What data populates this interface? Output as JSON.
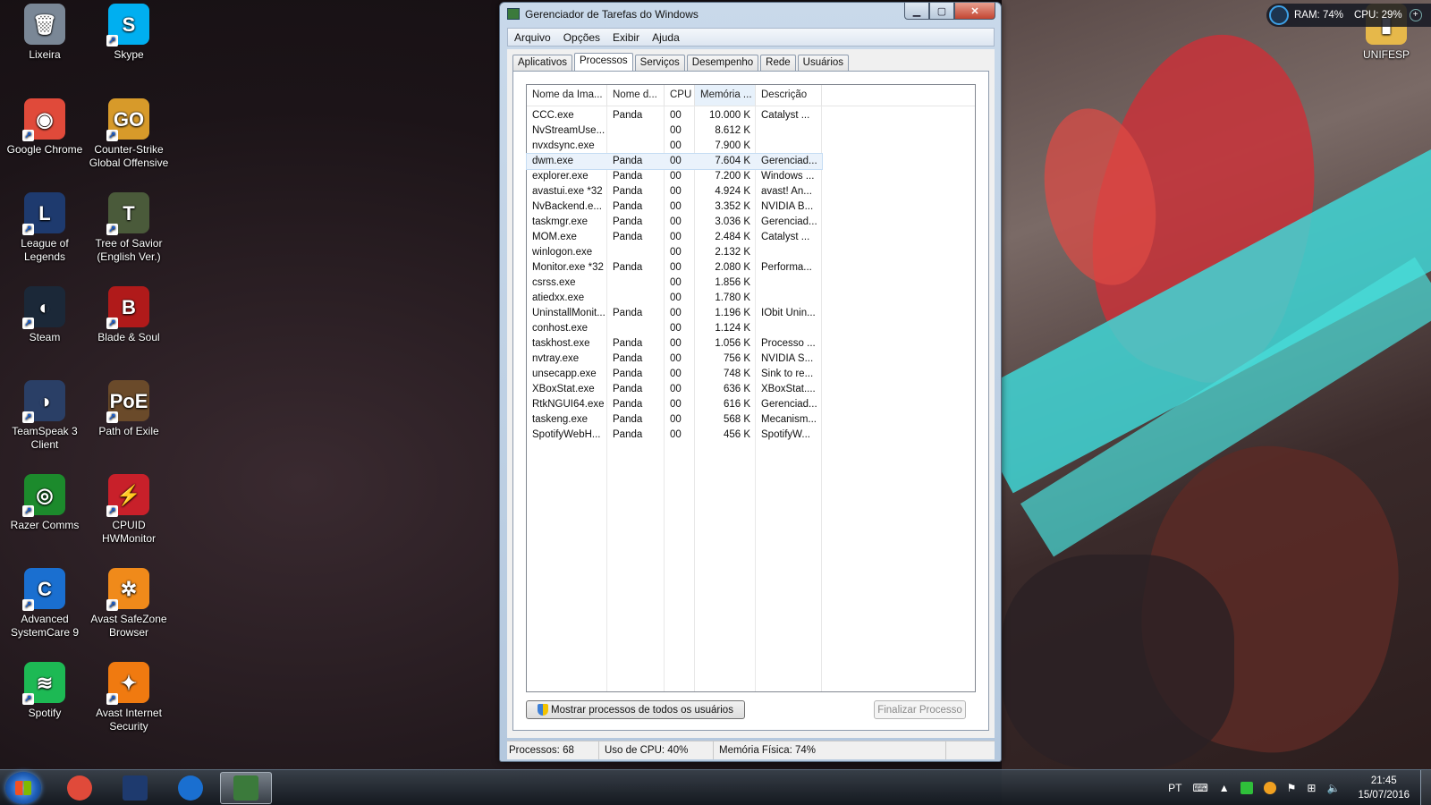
{
  "desktop": {
    "icons": [
      {
        "label": "Lixeira",
        "icon": "recycle-bin-icon",
        "glyph": "🗑",
        "color": "#7a8796"
      },
      {
        "label": "Skype",
        "icon": "skype-icon",
        "glyph": "S",
        "color": "#00aff0"
      },
      {
        "label": "Google Chrome",
        "icon": "chrome-icon",
        "glyph": "◉",
        "color": "#e04a3a"
      },
      {
        "label": "Counter-Strike Global Offensive",
        "icon": "csgo-icon",
        "glyph": "GO",
        "color": "#d79a2a"
      },
      {
        "label": "League of Legends",
        "icon": "league-of-legends-icon",
        "glyph": "L",
        "color": "#1e3a6e"
      },
      {
        "label": "Tree of Savior (English Ver.)",
        "icon": "tree-of-savior-icon",
        "glyph": "T",
        "color": "#4a5a3a"
      },
      {
        "label": "Steam",
        "icon": "steam-icon",
        "glyph": "◐",
        "color": "#1b2838"
      },
      {
        "label": "Blade & Soul",
        "icon": "blade-and-soul-icon",
        "glyph": "B",
        "color": "#b01a1a"
      },
      {
        "label": "TeamSpeak 3 Client",
        "icon": "teamspeak-icon",
        "glyph": "◑",
        "color": "#2a3f66"
      },
      {
        "label": "Path of Exile",
        "icon": "path-of-exile-icon",
        "glyph": "PoE",
        "color": "#6a4a2a"
      },
      {
        "label": "Razer Comms",
        "icon": "razer-comms-icon",
        "glyph": "◎",
        "color": "#1c8a2c"
      },
      {
        "label": "CPUID HWMonitor",
        "icon": "hwmonitor-icon",
        "glyph": "⚡",
        "color": "#c8202a"
      },
      {
        "label": "Advanced SystemCare 9",
        "icon": "advanced-systemcare-icon",
        "glyph": "C",
        "color": "#1a6fd0"
      },
      {
        "label": "Avast SafeZone Browser",
        "icon": "avast-safezone-icon",
        "glyph": "✲",
        "color": "#f08a1a"
      },
      {
        "label": "Spotify",
        "icon": "spotify-icon",
        "glyph": "≋",
        "color": "#1db954"
      },
      {
        "label": "Avast Internet Security",
        "icon": "avast-internet-security-icon",
        "glyph": "✦",
        "color": "#f07a10"
      },
      {
        "label": "UNIFESP",
        "icon": "folder-icon",
        "glyph": "▮",
        "color": "#e6b84a"
      }
    ]
  },
  "gadget": {
    "ram": "RAM: 74%",
    "cpu": "CPU: 29%"
  },
  "window": {
    "title": "Gerenciador de Tarefas do Windows",
    "menu": [
      "Arquivo",
      "Opções",
      "Exibir",
      "Ajuda"
    ],
    "tabs": [
      "Aplicativos",
      "Processos",
      "Serviços",
      "Desempenho",
      "Rede",
      "Usuários"
    ],
    "active_tab": "Processos",
    "columns": [
      "Nome da Ima...",
      "Nome d...",
      "CPU",
      "Memória ...",
      "Descrição"
    ],
    "processes": [
      {
        "image": "CCC.exe",
        "user": "Panda",
        "cpu": "00",
        "memory": "10.000 K",
        "description": "Catalyst ..."
      },
      {
        "image": "NvStreamUse...",
        "user": "",
        "cpu": "00",
        "memory": "8.612 K",
        "description": ""
      },
      {
        "image": "nvxdsync.exe",
        "user": "",
        "cpu": "00",
        "memory": "7.900 K",
        "description": ""
      },
      {
        "image": "dwm.exe",
        "user": "Panda",
        "cpu": "00",
        "memory": "7.604 K",
        "description": "Gerenciad..."
      },
      {
        "image": "explorer.exe",
        "user": "Panda",
        "cpu": "00",
        "memory": "7.200 K",
        "description": "Windows ..."
      },
      {
        "image": "avastui.exe *32",
        "user": "Panda",
        "cpu": "00",
        "memory": "4.924 K",
        "description": "avast! An..."
      },
      {
        "image": "NvBackend.e...",
        "user": "Panda",
        "cpu": "00",
        "memory": "3.352 K",
        "description": "NVIDIA B..."
      },
      {
        "image": "taskmgr.exe",
        "user": "Panda",
        "cpu": "00",
        "memory": "3.036 K",
        "description": "Gerenciad..."
      },
      {
        "image": "MOM.exe",
        "user": "Panda",
        "cpu": "00",
        "memory": "2.484 K",
        "description": "Catalyst ..."
      },
      {
        "image": "winlogon.exe",
        "user": "",
        "cpu": "00",
        "memory": "2.132 K",
        "description": ""
      },
      {
        "image": "Monitor.exe *32",
        "user": "Panda",
        "cpu": "00",
        "memory": "2.080 K",
        "description": "Performa..."
      },
      {
        "image": "csrss.exe",
        "user": "",
        "cpu": "00",
        "memory": "1.856 K",
        "description": ""
      },
      {
        "image": "atiedxx.exe",
        "user": "",
        "cpu": "00",
        "memory": "1.780 K",
        "description": ""
      },
      {
        "image": "UninstallMonit...",
        "user": "Panda",
        "cpu": "00",
        "memory": "1.196 K",
        "description": "IObit Unin..."
      },
      {
        "image": "conhost.exe",
        "user": "",
        "cpu": "00",
        "memory": "1.124 K",
        "description": ""
      },
      {
        "image": "taskhost.exe",
        "user": "Panda",
        "cpu": "00",
        "memory": "1.056 K",
        "description": "Processo ..."
      },
      {
        "image": "nvtray.exe",
        "user": "Panda",
        "cpu": "00",
        "memory": "756 K",
        "description": "NVIDIA S..."
      },
      {
        "image": "unsecapp.exe",
        "user": "Panda",
        "cpu": "00",
        "memory": "748 K",
        "description": "Sink to re..."
      },
      {
        "image": "XBoxStat.exe",
        "user": "Panda",
        "cpu": "00",
        "memory": "636 K",
        "description": "XBoxStat...."
      },
      {
        "image": "RtkNGUI64.exe",
        "user": "Panda",
        "cpu": "00",
        "memory": "616 K",
        "description": "Gerenciad..."
      },
      {
        "image": "taskeng.exe",
        "user": "Panda",
        "cpu": "00",
        "memory": "568 K",
        "description": "Mecanism..."
      },
      {
        "image": "SpotifyWebH...",
        "user": "Panda",
        "cpu": "00",
        "memory": "456 K",
        "description": "SpotifyW..."
      }
    ],
    "selected_row": "dwm.exe",
    "show_all_button": "Mostrar processos de todos os usuários",
    "end_process_button": "Finalizar Processo",
    "status": {
      "processes": "Processos: 68",
      "cpu": "Uso de CPU: 40%",
      "memory": "Memória Física: 74%"
    }
  },
  "taskbar": {
    "pinned": [
      {
        "name": "chrome",
        "icon": "chrome-icon",
        "color": "#e04a3a"
      },
      {
        "name": "league-of-legends",
        "icon": "league-of-legends-icon",
        "color": "#1e3a6e"
      },
      {
        "name": "advanced-systemcare",
        "icon": "advanced-systemcare-icon",
        "color": "#1a6fd0"
      },
      {
        "name": "task-manager",
        "icon": "task-manager-icon",
        "color": "#3b7a3b"
      }
    ],
    "language": "PT",
    "time": "21:45",
    "date": "15/07/2016"
  }
}
